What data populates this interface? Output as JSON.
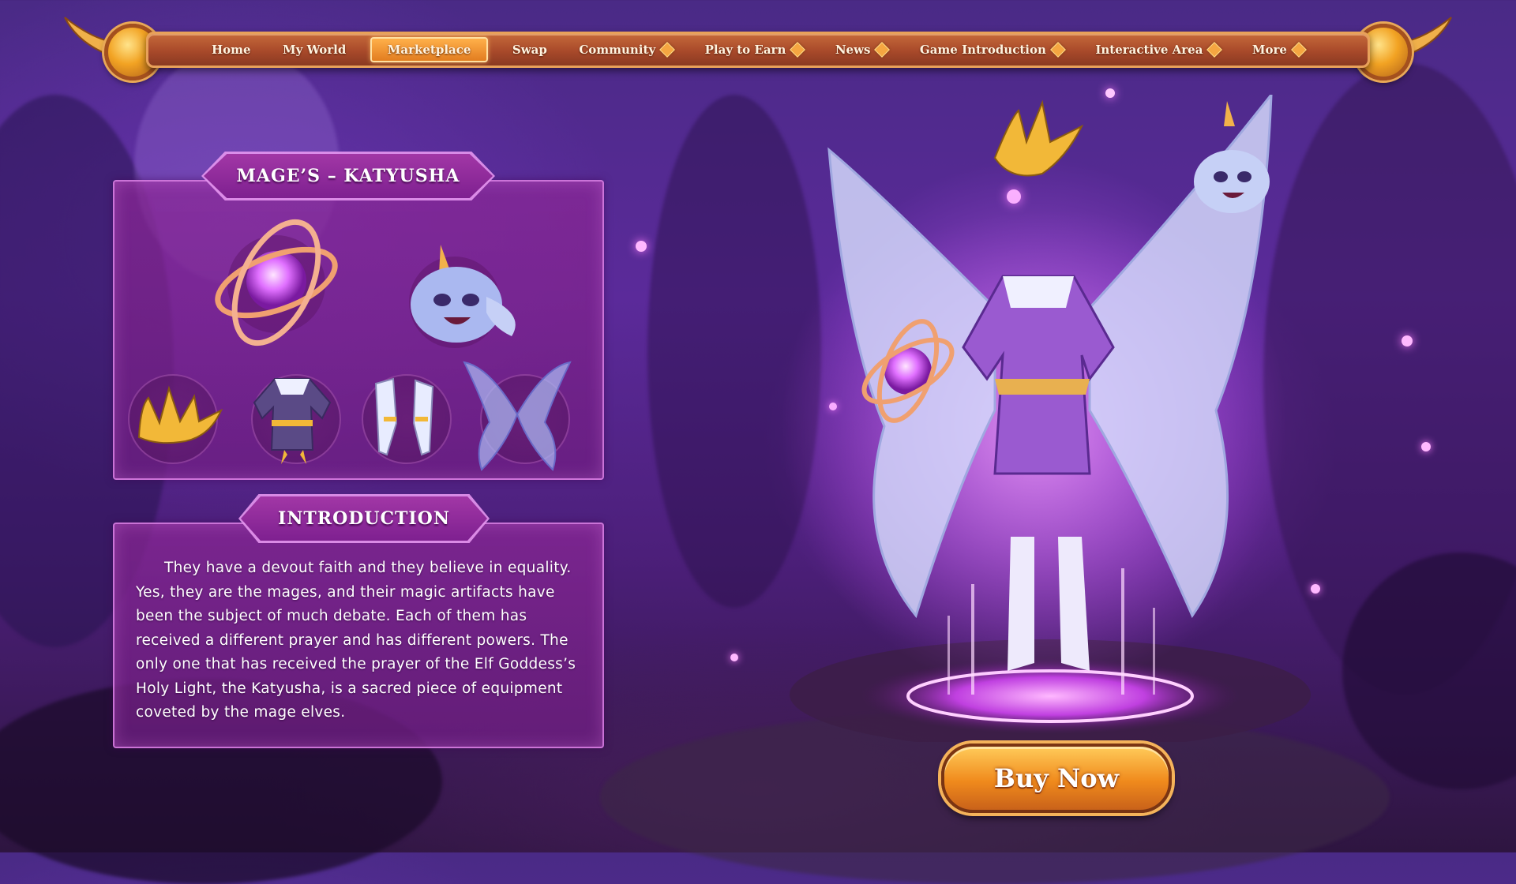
{
  "nav": {
    "items": [
      {
        "label": "Home",
        "active": false,
        "dropdown": false
      },
      {
        "label": "My World",
        "active": false,
        "dropdown": false
      },
      {
        "label": "Marketplace",
        "active": true,
        "dropdown": false
      },
      {
        "label": "Swap",
        "active": false,
        "dropdown": false
      },
      {
        "label": "Community",
        "active": false,
        "dropdown": true
      },
      {
        "label": "Play to Earn",
        "active": false,
        "dropdown": true
      },
      {
        "label": "News",
        "active": false,
        "dropdown": true
      },
      {
        "label": "Game Introduction",
        "active": false,
        "dropdown": true
      },
      {
        "label": "Interactive Area",
        "active": false,
        "dropdown": true
      },
      {
        "label": "More",
        "active": false,
        "dropdown": true
      }
    ]
  },
  "item_panel": {
    "title": "MAGE’S – KATYUSHA",
    "items": [
      "orb-artifact-icon",
      "pet-spirit-icon",
      "crown-icon",
      "robe-icon",
      "gloves-icon",
      "wings-icon"
    ]
  },
  "intro_panel": {
    "title": "INTRODUCTION",
    "text": "They have a devout faith and they believe in equality. Yes, they are the mages, and their magic artifacts have been the subject of much debate. Each of them has received a different prayer and has different powers. The only one that has received the prayer of the Elf Goddess’s Holy Light, the Katyusha, is a sacred piece of equipment coveted by the mage elves."
  },
  "buy_button": {
    "label": "Buy Now"
  },
  "colors": {
    "accent": "#f08a1c",
    "panel": "#8c2896",
    "nav": "#a8492a",
    "glow": "#e070ff"
  }
}
